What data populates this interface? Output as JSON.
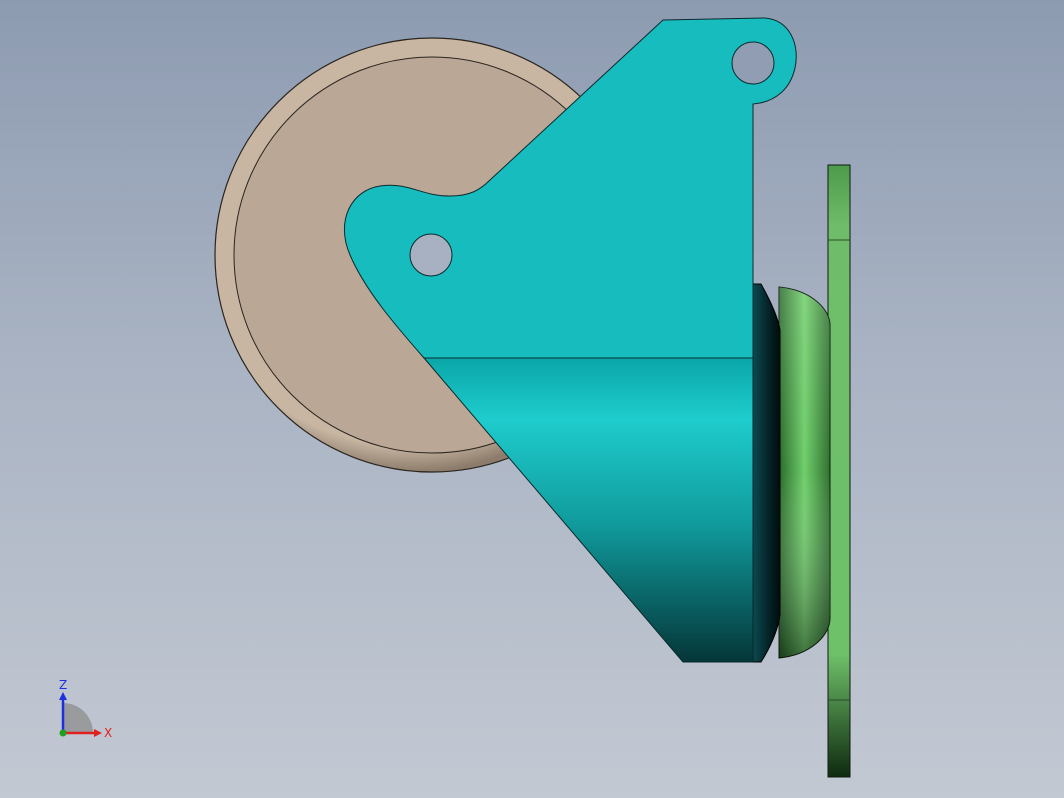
{
  "window": {
    "title": ""
  },
  "viewport": {
    "background_top": "#8d9bb1",
    "background_bottom": "#c3c9d3"
  },
  "model": {
    "parts": [
      {
        "name": "wheel",
        "color": "#bcaa98"
      },
      {
        "name": "fork-bracket",
        "color": "#17bcbf"
      },
      {
        "name": "axle-hole",
        "color": "#a7b1c2"
      },
      {
        "name": "bearing-cone",
        "color": "#0a3a40"
      },
      {
        "name": "swivel-dome",
        "color": "#4e9a4c"
      },
      {
        "name": "mounting-plate",
        "color": "#6fbd6a"
      }
    ]
  },
  "triad": {
    "z_label": "Z",
    "x_label": "X",
    "z_color": "#1f2fe0",
    "x_color": "#e01f1f",
    "y_color": "#1fa01f"
  }
}
